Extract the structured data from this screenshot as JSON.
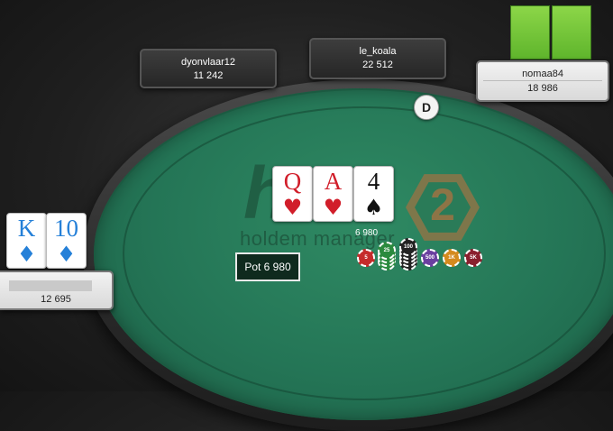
{
  "players": {
    "dyonvlaar12": {
      "name": "dyonvlaar12",
      "stack": "11 242"
    },
    "le_koala": {
      "name": "le_koala",
      "stack": "22 512"
    },
    "nomaa84": {
      "name": "nomaa84",
      "stack": "18 986"
    },
    "hero": {
      "stack": "12 695"
    }
  },
  "hero_cards": [
    {
      "rank": "K",
      "suit": "♦",
      "color": "#2580d8"
    },
    {
      "rank": "10",
      "suit": "♦",
      "color": "#2580d8"
    }
  ],
  "board_cards": [
    {
      "rank": "Q",
      "suit": "♥",
      "color": "#d11e2a"
    },
    {
      "rank": "A",
      "suit": "♥",
      "color": "#d11e2a"
    },
    {
      "rank": "4",
      "suit": "♠",
      "color": "#111111"
    }
  ],
  "dealer_button": "D",
  "pot_label": "Pot 6 980",
  "bet_amount": "6 980",
  "chips": [
    "5",
    "25",
    "100",
    "500",
    "1K",
    "5K"
  ],
  "logo": {
    "wordmark": "holdem manager",
    "letter": "h",
    "number": "2"
  },
  "colors": {
    "felt": "#247556",
    "rim": "#2a2a2a",
    "action_green": "#6bc234"
  }
}
